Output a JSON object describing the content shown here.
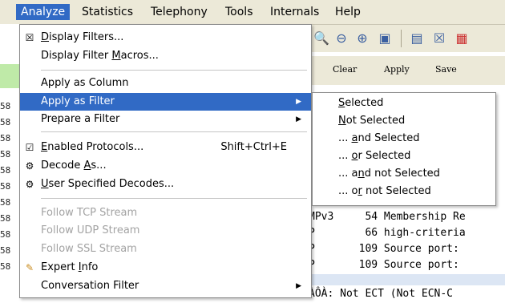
{
  "menubar": {
    "items": [
      "Analyze",
      "Statistics",
      "Telephony",
      "Tools",
      "Internals",
      "Help"
    ]
  },
  "filterbar": {
    "clear_label": "Clear",
    "apply_label": "Apply",
    "save_label": "Save"
  },
  "left_strip": {
    "rows": [
      "58",
      "58",
      "58",
      "58",
      "58",
      "58",
      "58",
      "58",
      "58",
      "58",
      "58",
      "58"
    ]
  },
  "menu": {
    "display_filters": "Display Filters...",
    "display_filter_macros": "Display Filter Macros...",
    "apply_as_column": "Apply as Column",
    "apply_as_filter": "Apply as Filter",
    "prepare_a_filter": "Prepare a Filter",
    "enabled_protocols": "Enabled Protocols...",
    "enabled_protocols_shortcut": "Shift+Ctrl+E",
    "decode_as": "Decode As...",
    "user_specified_decodes": "User Specified Decodes...",
    "follow_tcp_stream": "Follow TCP Stream",
    "follow_udp_stream": "Follow UDP Stream",
    "follow_ssl_stream": "Follow SSL Stream",
    "expert_info": "Expert Info",
    "conversation_filter": "Conversation Filter"
  },
  "submenu": {
    "items": [
      "Selected",
      "Not Selected",
      "... and Selected",
      "... or Selected",
      "... and not Selected",
      "... or not Selected"
    ]
  },
  "packets": {
    "rows": [
      "MPv3     54 Membership Re",
      "P        66 high-criteria",
      "P       109 Source port:",
      "P       109 Source port:",
      "ÀÔÀ: Not ECT (Not ECN-C"
    ],
    "partial_text": "66 high-criteria"
  },
  "colors": {
    "highlight": "#316ac5",
    "chrome": "#ece9d8",
    "green_row": "#bfeaa8"
  }
}
